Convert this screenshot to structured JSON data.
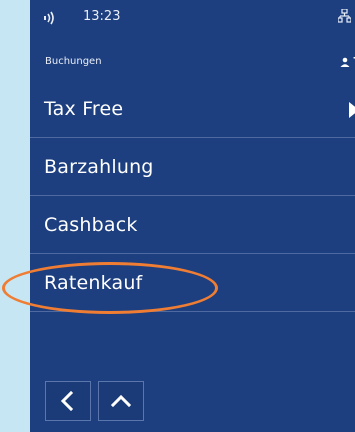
{
  "status": {
    "time": "13:23"
  },
  "header": {
    "breadcrumb": "Buchungen",
    "user_initial": "T"
  },
  "menu": {
    "items": [
      {
        "label": "Tax Free",
        "has_arrow": true
      },
      {
        "label": "Barzahlung"
      },
      {
        "label": "Cashback"
      },
      {
        "label": "Ratenkauf",
        "highlighted": true
      }
    ]
  },
  "navigation": {
    "back_icon": "chevron-left-icon",
    "up_icon": "chevron-up-icon"
  },
  "colors": {
    "screen_bg": "#1d3f7f",
    "page_bg": "#c7e6f3",
    "highlight": "#ef7d33"
  }
}
